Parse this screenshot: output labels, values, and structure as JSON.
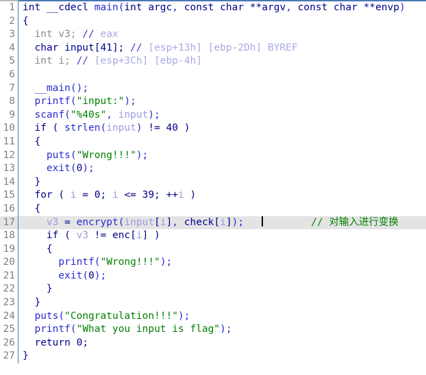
{
  "view": {
    "title": "Pseudocode",
    "current_line": 17,
    "total_lines": 27,
    "colors": {
      "background": "#ffffff",
      "gutter_text": "#808080",
      "gutter_separator": "#4a78b4",
      "current_line_highlight": "#e4e4e4",
      "keyword": "#00008b",
      "function": "#2a2ad2",
      "string": "#008000",
      "comment": "#008000",
      "local_variable": "#9a9ae0",
      "declaration": "#8a8a8a",
      "stack_annotation": "#a9a9e6",
      "caret": "#000000"
    }
  },
  "code": {
    "lines": [
      {
        "number": "1",
        "tokens": [
          {
            "t": "int ",
            "c": "k"
          },
          {
            "t": "__cdecl ",
            "c": "k"
          },
          {
            "t": "main",
            "c": "fn"
          },
          {
            "t": "(",
            "c": "fn"
          },
          {
            "t": "int ",
            "c": "k"
          },
          {
            "t": "argc",
            "c": "k"
          },
          {
            "t": ", ",
            "c": "fn"
          },
          {
            "t": "const ",
            "c": "k"
          },
          {
            "t": "char ",
            "c": "k"
          },
          {
            "t": "**",
            "c": "k"
          },
          {
            "t": "argv",
            "c": "k"
          },
          {
            "t": ", ",
            "c": "fn"
          },
          {
            "t": "const ",
            "c": "k"
          },
          {
            "t": "char ",
            "c": "k"
          },
          {
            "t": "**",
            "c": "k"
          },
          {
            "t": "envp",
            "c": "k"
          },
          {
            "t": ")",
            "c": "fn"
          }
        ]
      },
      {
        "number": "2",
        "tokens": [
          {
            "t": "{",
            "c": "k"
          }
        ]
      },
      {
        "number": "3",
        "tokens": [
          {
            "t": "  int v3; ",
            "c": "decl"
          },
          {
            "t": "// ",
            "c": "dcmt"
          },
          {
            "t": "eax",
            "c": "dloc"
          }
        ]
      },
      {
        "number": "4",
        "tokens": [
          {
            "t": "  char ",
            "c": "k"
          },
          {
            "t": "input",
            "c": "k"
          },
          {
            "t": "[41]; ",
            "c": "k"
          },
          {
            "t": "// ",
            "c": "dcmt"
          },
          {
            "t": "[esp+13h] [ebp-2Dh] BYREF",
            "c": "dloc"
          }
        ]
      },
      {
        "number": "5",
        "tokens": [
          {
            "t": "  int i; ",
            "c": "decl"
          },
          {
            "t": "// ",
            "c": "dcmt"
          },
          {
            "t": "[esp+3Ch] [ebp-4h]",
            "c": "dloc"
          }
        ]
      },
      {
        "number": "6",
        "tokens": [
          {
            "t": "",
            "c": "k"
          }
        ]
      },
      {
        "number": "7",
        "tokens": [
          {
            "t": "  ",
            "c": "k"
          },
          {
            "t": "__main",
            "c": "fn"
          },
          {
            "t": "();",
            "c": "fn"
          }
        ]
      },
      {
        "number": "8",
        "tokens": [
          {
            "t": "  ",
            "c": "k"
          },
          {
            "t": "printf",
            "c": "fn"
          },
          {
            "t": "(",
            "c": "fn"
          },
          {
            "t": "\"input:\"",
            "c": "str"
          },
          {
            "t": ");",
            "c": "fn"
          }
        ]
      },
      {
        "number": "9",
        "tokens": [
          {
            "t": "  ",
            "c": "k"
          },
          {
            "t": "scanf",
            "c": "fn"
          },
          {
            "t": "(",
            "c": "fn"
          },
          {
            "t": "\"%40s\"",
            "c": "str"
          },
          {
            "t": ", ",
            "c": "fn"
          },
          {
            "t": "input",
            "c": "var"
          },
          {
            "t": ");",
            "c": "fn"
          }
        ]
      },
      {
        "number": "10",
        "tokens": [
          {
            "t": "  if ( ",
            "c": "k"
          },
          {
            "t": "strlen",
            "c": "fn"
          },
          {
            "t": "(",
            "c": "fn"
          },
          {
            "t": "input",
            "c": "var"
          },
          {
            "t": ")",
            "c": "fn"
          },
          {
            "t": " != ",
            "c": "k"
          },
          {
            "t": "40",
            "c": "num"
          },
          {
            "t": " )",
            "c": "k"
          }
        ]
      },
      {
        "number": "11",
        "tokens": [
          {
            "t": "  {",
            "c": "k"
          }
        ]
      },
      {
        "number": "12",
        "tokens": [
          {
            "t": "    ",
            "c": "k"
          },
          {
            "t": "puts",
            "c": "fn"
          },
          {
            "t": "(",
            "c": "fn"
          },
          {
            "t": "\"Wrong!!!\"",
            "c": "str"
          },
          {
            "t": ");",
            "c": "fn"
          }
        ]
      },
      {
        "number": "13",
        "tokens": [
          {
            "t": "    ",
            "c": "k"
          },
          {
            "t": "exit",
            "c": "fn"
          },
          {
            "t": "(",
            "c": "fn"
          },
          {
            "t": "0",
            "c": "num"
          },
          {
            "t": ");",
            "c": "fn"
          }
        ]
      },
      {
        "number": "14",
        "tokens": [
          {
            "t": "  }",
            "c": "k"
          }
        ]
      },
      {
        "number": "15",
        "tokens": [
          {
            "t": "  for ( ",
            "c": "k"
          },
          {
            "t": "i",
            "c": "var"
          },
          {
            "t": " = ",
            "c": "k"
          },
          {
            "t": "0",
            "c": "num"
          },
          {
            "t": "; ",
            "c": "k"
          },
          {
            "t": "i",
            "c": "var"
          },
          {
            "t": " <= ",
            "c": "k"
          },
          {
            "t": "39",
            "c": "num"
          },
          {
            "t": "; ++",
            "c": "k"
          },
          {
            "t": "i",
            "c": "var"
          },
          {
            "t": " )",
            "c": "k"
          }
        ]
      },
      {
        "number": "16",
        "tokens": [
          {
            "t": "  {",
            "c": "k"
          }
        ]
      },
      {
        "number": "17",
        "current": true,
        "tokens": [
          {
            "t": "    ",
            "c": "k"
          },
          {
            "t": "v3",
            "c": "var"
          },
          {
            "t": " = ",
            "c": "k"
          },
          {
            "t": "encrypt",
            "c": "fn"
          },
          {
            "t": "(",
            "c": "fn"
          },
          {
            "t": "input",
            "c": "var"
          },
          {
            "t": "[",
            "c": "k"
          },
          {
            "t": "i",
            "c": "var"
          },
          {
            "t": "]",
            "c": "k"
          },
          {
            "t": ", ",
            "c": "fn"
          },
          {
            "t": "check",
            "c": "k"
          },
          {
            "t": "[",
            "c": "k"
          },
          {
            "t": "i",
            "c": "var"
          },
          {
            "t": "]",
            "c": "k"
          },
          {
            "t": ");",
            "c": "fn"
          }
        ],
        "caret": true,
        "trailing_comment": "// 对输入进行变换"
      },
      {
        "number": "18",
        "tokens": [
          {
            "t": "    if ( ",
            "c": "k"
          },
          {
            "t": "v3",
            "c": "var"
          },
          {
            "t": " != ",
            "c": "k"
          },
          {
            "t": "enc",
            "c": "k"
          },
          {
            "t": "[",
            "c": "k"
          },
          {
            "t": "i",
            "c": "var"
          },
          {
            "t": "]",
            "c": "k"
          },
          {
            "t": " )",
            "c": "k"
          }
        ]
      },
      {
        "number": "19",
        "tokens": [
          {
            "t": "    {",
            "c": "k"
          }
        ]
      },
      {
        "number": "20",
        "tokens": [
          {
            "t": "      ",
            "c": "k"
          },
          {
            "t": "printf",
            "c": "fn"
          },
          {
            "t": "(",
            "c": "fn"
          },
          {
            "t": "\"Wrong!!!\"",
            "c": "str"
          },
          {
            "t": ");",
            "c": "fn"
          }
        ]
      },
      {
        "number": "21",
        "tokens": [
          {
            "t": "      ",
            "c": "k"
          },
          {
            "t": "exit",
            "c": "fn"
          },
          {
            "t": "(",
            "c": "fn"
          },
          {
            "t": "0",
            "c": "num"
          },
          {
            "t": ");",
            "c": "fn"
          }
        ]
      },
      {
        "number": "22",
        "tokens": [
          {
            "t": "    }",
            "c": "k"
          }
        ]
      },
      {
        "number": "23",
        "tokens": [
          {
            "t": "  }",
            "c": "k"
          }
        ]
      },
      {
        "number": "24",
        "tokens": [
          {
            "t": "  ",
            "c": "k"
          },
          {
            "t": "puts",
            "c": "fn"
          },
          {
            "t": "(",
            "c": "fn"
          },
          {
            "t": "\"Congratulation!!!\"",
            "c": "str"
          },
          {
            "t": ");",
            "c": "fn"
          }
        ]
      },
      {
        "number": "25",
        "tokens": [
          {
            "t": "  ",
            "c": "k"
          },
          {
            "t": "printf",
            "c": "fn"
          },
          {
            "t": "(",
            "c": "fn"
          },
          {
            "t": "\"What you input is flag\"",
            "c": "str"
          },
          {
            "t": ");",
            "c": "fn"
          }
        ]
      },
      {
        "number": "26",
        "tokens": [
          {
            "t": "  return ",
            "c": "k"
          },
          {
            "t": "0",
            "c": "num"
          },
          {
            "t": ";",
            "c": "k"
          }
        ]
      },
      {
        "number": "27",
        "tokens": [
          {
            "t": "}",
            "c": "k"
          }
        ]
      }
    ]
  }
}
